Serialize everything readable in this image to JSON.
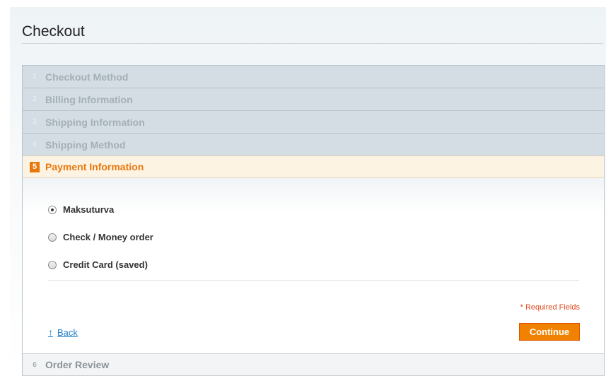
{
  "page": {
    "title": "Checkout"
  },
  "steps": [
    {
      "number": "1",
      "label": "Checkout Method",
      "state": "inactive"
    },
    {
      "number": "2",
      "label": "Billing Information",
      "state": "inactive"
    },
    {
      "number": "3",
      "label": "Shipping Information",
      "state": "inactive"
    },
    {
      "number": "4",
      "label": "Shipping Method",
      "state": "inactive"
    },
    {
      "number": "5",
      "label": "Payment Information",
      "state": "active"
    },
    {
      "number": "6",
      "label": "Order Review",
      "state": "pending"
    }
  ],
  "payment": {
    "methods": [
      {
        "label": "Maksuturva",
        "checked": true
      },
      {
        "label": "Check / Money order",
        "checked": false
      },
      {
        "label": "Credit Card (saved)",
        "checked": false
      }
    ],
    "required_note": "* Required Fields",
    "back_label": "Back",
    "back_icon": "up-arrow-icon",
    "continue_label": "Continue"
  },
  "colors": {
    "accent": "#e8780d",
    "button": "#f18200",
    "link": "#1e7ec8",
    "required": "#e0461c"
  }
}
